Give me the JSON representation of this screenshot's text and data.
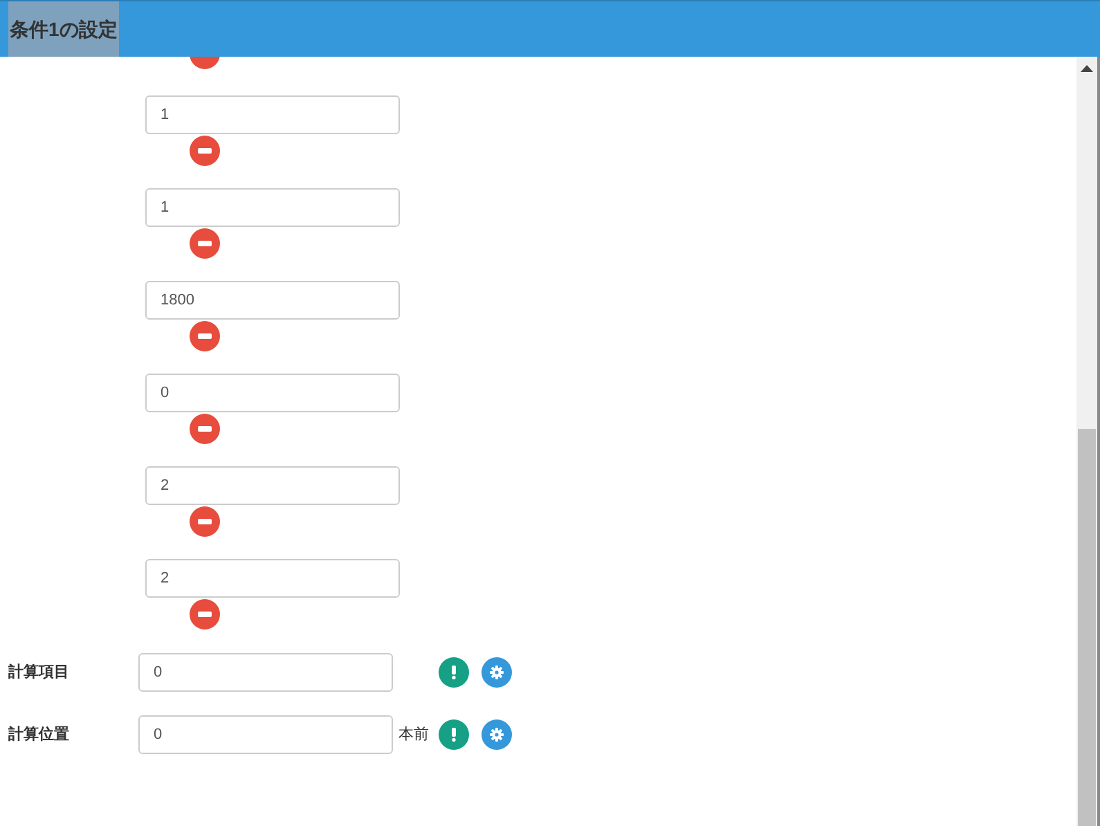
{
  "header": {
    "title": "条件1の設定"
  },
  "values": [
    "1",
    "1",
    "1800",
    "0",
    "2",
    "2"
  ],
  "fields": [
    {
      "label": "計算項目",
      "value": "0"
    },
    {
      "label": "計算位置",
      "value": "0",
      "suffix": "本前"
    }
  ]
}
